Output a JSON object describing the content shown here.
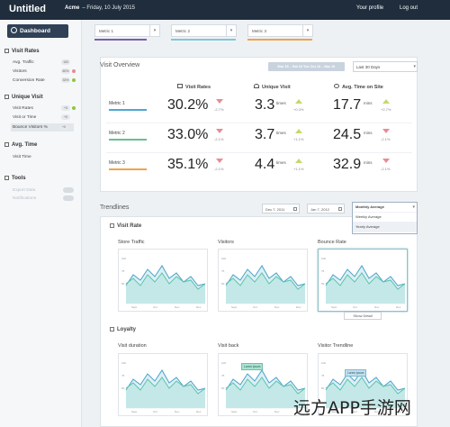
{
  "topbar": {
    "app_title": "Untitled",
    "org": "Acme",
    "date": "– Friday, 10 July 2015",
    "profile": "Your profile",
    "logout": "Log out"
  },
  "sidebar": {
    "dashboard": "Dashboard",
    "sections": [
      {
        "title": "Visit Rates",
        "items": [
          {
            "label": "Avg. Traffic",
            "badge": "100"
          },
          {
            "label": "Visitors",
            "badge": "60%",
            "dot": "#e88b93"
          },
          {
            "label": "Conversion Rate",
            "badge": "33%"
          }
        ]
      },
      {
        "title": "Unique Visit",
        "items": [
          {
            "label": "Visit Rates",
            "badge": "+3"
          },
          {
            "label": "Visit or Time",
            "badge": "+0"
          },
          {
            "label": "Bounce Visitors %",
            "badge": "+0"
          }
        ]
      },
      {
        "title": "Avg. Time",
        "items": [
          {
            "label": "Visit Time"
          }
        ]
      },
      {
        "title": "Tools",
        "items": [
          {
            "label": "Export Data"
          },
          {
            "label": "Notifications"
          }
        ]
      }
    ]
  },
  "selectors": [
    {
      "label": "Metric 1",
      "color": "#7b5ea7"
    },
    {
      "label": "Metric 2",
      "color": "#7cc8d6"
    },
    {
      "label": "Metric 3",
      "color": "#f0a24a"
    }
  ],
  "overview": {
    "title": "Visit Overview",
    "date_range": "Mar 15 – Sat 16 Tue Oct 16 – Mar 16",
    "period": "Last 30 Days",
    "columns": [
      "Visit Rates",
      "Unique Visit",
      "Avg. Time on Site"
    ],
    "rows": [
      {
        "name": "Metric 1",
        "color": "#4fa6d6",
        "rate": "30.2%",
        "rate_chg": "-2.7%",
        "rate_dir": "down",
        "uv": "3.3",
        "uv_unit": "times",
        "uv_chg": "+0.3%",
        "uv_dir": "up",
        "time": "17.7",
        "time_unit": "mins",
        "time_chg": "+2.7%",
        "time_dir": "up"
      },
      {
        "name": "Metric 2",
        "color": "#67c08f",
        "rate": "33.0%",
        "rate_chg": "-2.1%",
        "rate_dir": "down",
        "uv": "3.7",
        "uv_unit": "times",
        "uv_chg": "+1.1%",
        "uv_dir": "up",
        "time": "24.5",
        "time_unit": "mins",
        "time_chg": "-2.1%",
        "time_dir": "down"
      },
      {
        "name": "Metric 3",
        "color": "#f0a24a",
        "rate": "35.1%",
        "rate_chg": "-2.1%",
        "rate_dir": "down",
        "uv": "4.4",
        "uv_unit": "times",
        "uv_chg": "+1.1%",
        "uv_dir": "up",
        "time": "32.9",
        "time_unit": "mins",
        "time_chg": "-2.1%",
        "time_dir": "down"
      }
    ]
  },
  "trendlines": {
    "title": "Trendlines",
    "from": "Dec 7, 2011",
    "to": "Jan 7, 2012",
    "aggregation": {
      "selected": "Monthly Average",
      "options": [
        "Weekly Average",
        "Yearly Average"
      ]
    },
    "groups": [
      {
        "title": "Visit Rate",
        "charts": [
          "Store Traffic",
          "Visitors",
          "Bounce Rate"
        ]
      },
      {
        "title": "Loyalty",
        "charts": [
          "Visit duration",
          "Visit back",
          "Visitor Trendline"
        ]
      }
    ],
    "axis_labels": [
      "Sept",
      "Oct",
      "Nov",
      "Dec"
    ],
    "y_labels": [
      "100",
      "75",
      "50"
    ],
    "show_detail": "Show Detail",
    "tip_green": "Lorem ipsum",
    "tip_blue": "Lorem ipsum"
  },
  "watermark": "远方APP手游网"
}
